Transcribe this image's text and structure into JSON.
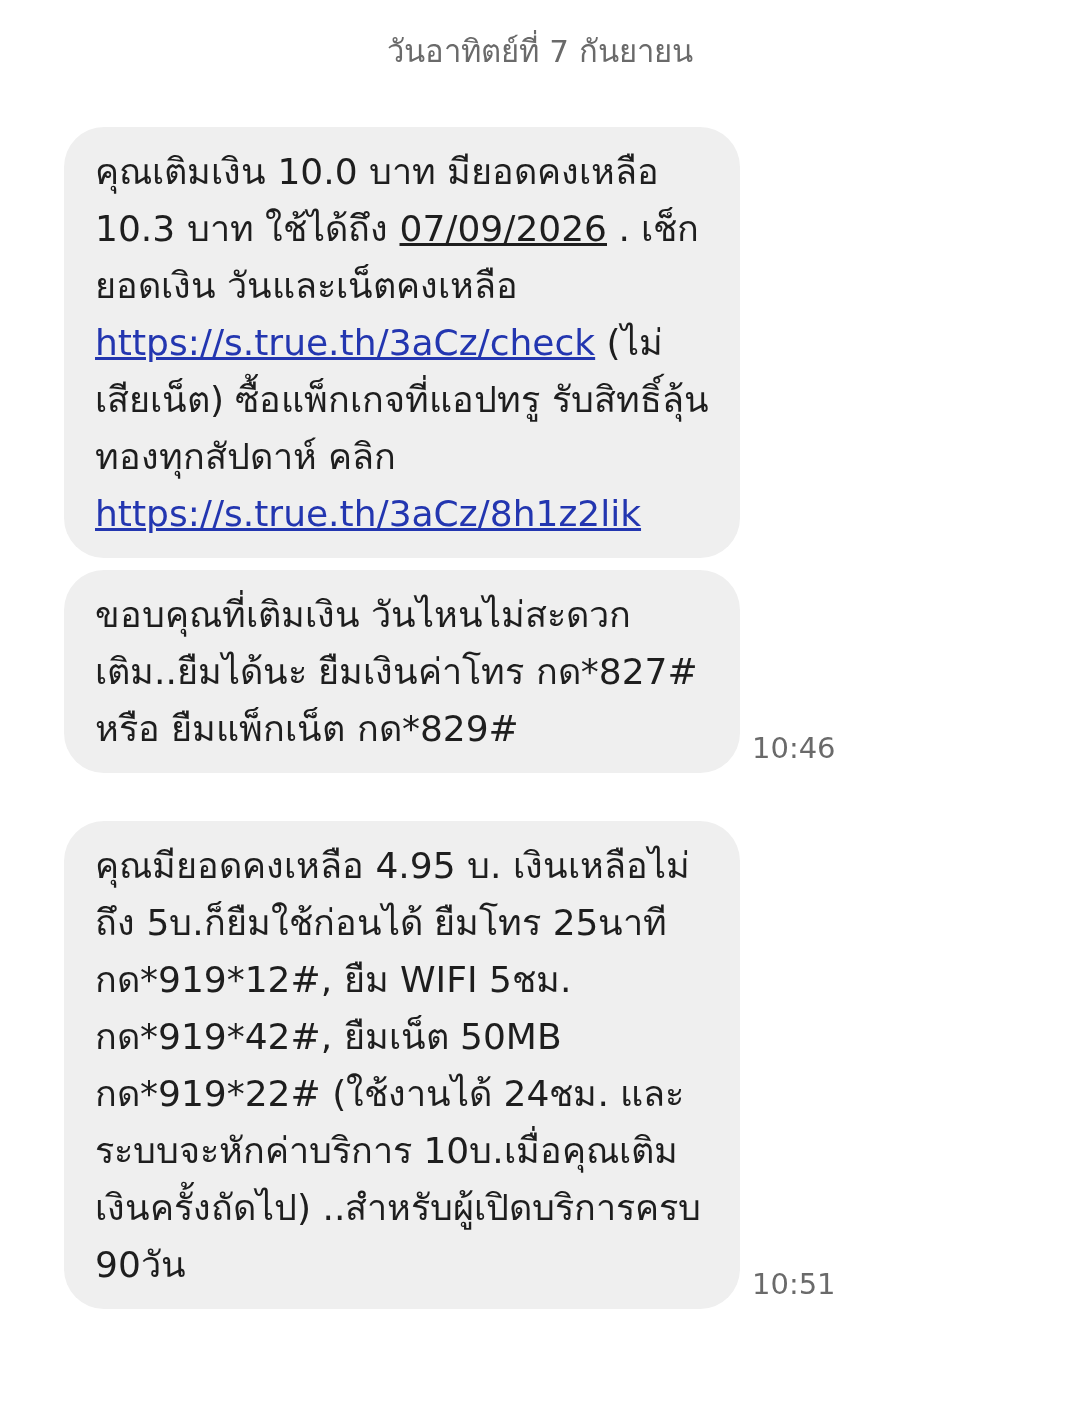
{
  "date_header": "วันอาทิตย์ที่ 7 กันยายน",
  "groups": [
    {
      "time": "10:46",
      "messages": [
        {
          "segments": [
            {
              "kind": "text",
              "text": "คุณเติมเงิน 10.0 บาท มียอดคงเหลือ 10.3 บาท ใช้ได้ถึง "
            },
            {
              "kind": "date",
              "text": "07/09/2026"
            },
            {
              "kind": "text",
              "text": " . เช็กยอดเงิน วันและเน็ตคงเหลือ "
            },
            {
              "kind": "link",
              "text": "https://s.true.th/3aCz/check"
            },
            {
              "kind": "text",
              "text": " (ไม่เสียเน็ต) ซื้อแพ็กเกจที่แอปทรู รับสิทธิ์ลุ้นทองทุกสัปดาห์ คลิก "
            },
            {
              "kind": "link",
              "text": "https://s.true.th/3aCz/8h1z2lik"
            }
          ]
        },
        {
          "segments": [
            {
              "kind": "text",
              "text": "ขอบคุณที่เติมเงิน วันไหนไม่สะดวกเติม..ยืมได้นะ ยืมเงินค่าโทร กด*827# หรือ ยืมแพ็กเน็ต กด*829#"
            }
          ]
        }
      ]
    },
    {
      "time": "10:51",
      "messages": [
        {
          "segments": [
            {
              "kind": "text",
              "text": "คุณมียอดคงเหลือ 4.95 บ. เงินเหลือไม่ถึง 5บ.ก็ยืมใช้ก่อนได้ ยืมโทร 25นาที กด*919*12#, ยืม WIFI 5ชม. กด*919*42#, ยืมเน็ต 50MB กด*919*22# (ใช้งานได้ 24ชม. และระบบจะหักค่าบริการ 10บ.เมื่อคุณเติมเงินครั้งถัดไป) ..สำหรับผู้เปิดบริการครบ 90วัน"
            }
          ]
        }
      ]
    }
  ]
}
